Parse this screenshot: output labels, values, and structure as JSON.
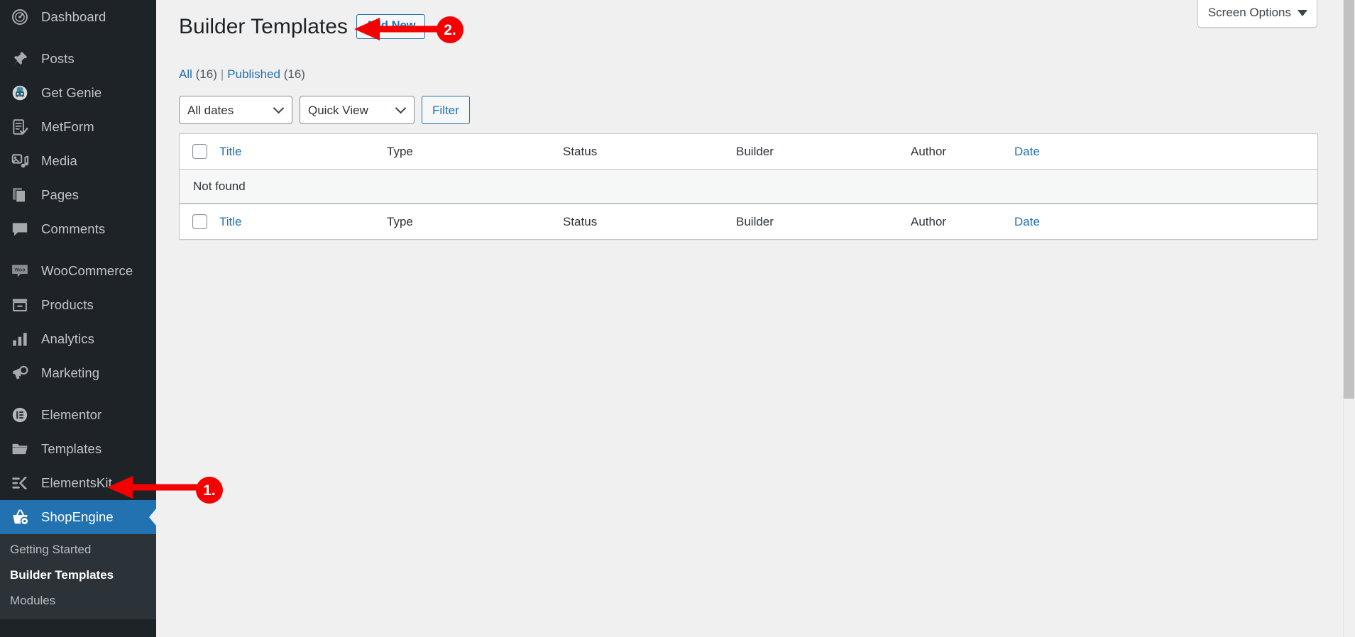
{
  "sidebar": {
    "items": [
      {
        "label": "Dashboard",
        "icon": "dashboard-icon",
        "gap_after": true
      },
      {
        "label": "Posts",
        "icon": "pin-icon",
        "gap_after": false
      },
      {
        "label": "Get Genie",
        "icon": "robot-icon",
        "gap_after": false
      },
      {
        "label": "MetForm",
        "icon": "form-icon",
        "gap_after": false
      },
      {
        "label": "Media",
        "icon": "media-icon",
        "gap_after": false
      },
      {
        "label": "Pages",
        "icon": "pages-icon",
        "gap_after": false
      },
      {
        "label": "Comments",
        "icon": "comment-icon",
        "gap_after": true
      },
      {
        "label": "WooCommerce",
        "icon": "woo-icon",
        "gap_after": false
      },
      {
        "label": "Products",
        "icon": "products-icon",
        "gap_after": false
      },
      {
        "label": "Analytics",
        "icon": "bar-chart-icon",
        "gap_after": false
      },
      {
        "label": "Marketing",
        "icon": "megaphone-icon",
        "gap_after": true
      },
      {
        "label": "Elementor",
        "icon": "elementor-icon",
        "gap_after": false
      },
      {
        "label": "Templates",
        "icon": "folder-icon",
        "gap_after": false
      },
      {
        "label": "ElementsKit",
        "icon": "elementskit-icon",
        "gap_after": false
      }
    ],
    "current": {
      "label": "ShopEngine",
      "icon": "shopengine-basket-icon"
    },
    "submenu": [
      {
        "label": "Getting Started",
        "current": false
      },
      {
        "label": "Builder Templates",
        "current": true
      },
      {
        "label": "Modules",
        "current": false
      }
    ]
  },
  "screen_meta": {
    "screen_options_label": "Screen Options"
  },
  "header": {
    "title": "Builder Templates",
    "add_new_label": "Add New"
  },
  "views": {
    "all_label": "All",
    "all_count": "(16)",
    "divider": "|",
    "published_label": "Published",
    "published_count": "(16)"
  },
  "tablenav": {
    "date_filter_value": "All dates",
    "view_filter_value": "Quick View",
    "filter_button_label": "Filter"
  },
  "table": {
    "columns": {
      "title": "Title",
      "type": "Type",
      "status": "Status",
      "builder": "Builder",
      "author": "Author",
      "date": "Date"
    },
    "empty_message": "Not found",
    "rows": []
  },
  "annotations": {
    "step1": {
      "number": "1.",
      "points_to": "Builder Templates"
    },
    "step2": {
      "number": "2.",
      "points_to": "Add New"
    }
  },
  "colors": {
    "sidebar_bg": "#1d2327",
    "submenu_bg": "#2c3338",
    "accent_blue": "#2271b1",
    "annotation_red": "#f40000",
    "content_bg": "#f0f0f1"
  }
}
